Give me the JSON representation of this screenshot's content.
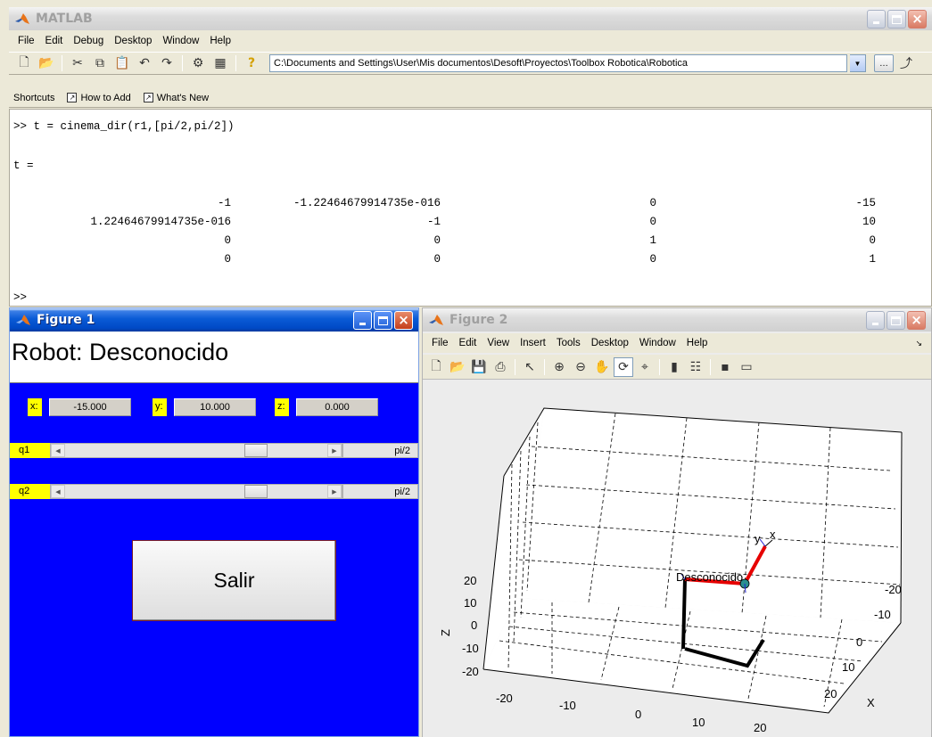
{
  "matlab": {
    "title": "MATLAB",
    "menu": [
      "File",
      "Edit",
      "Debug",
      "Desktop",
      "Window",
      "Help"
    ],
    "current_folder": "C:\\Documents and Settings\\User\\Mis documentos\\Desoft\\Proyectos\\Toolbox Robotica\\Robotica",
    "shortcuts": {
      "label": "Shortcuts",
      "how_to_add": "How to Add",
      "whats_new": "What's New"
    },
    "command_window": {
      "command": ">> t = cinema_dir(r1,[pi/2,pi/2])",
      "output_var": "t =",
      "matrix": [
        [
          "-1",
          "-1.22464679914735e-016",
          "0",
          "-15"
        ],
        [
          "1.22464679914735e-016",
          "-1",
          "0",
          "10"
        ],
        [
          "0",
          "0",
          "1",
          "0"
        ],
        [
          "0",
          "0",
          "0",
          "1"
        ]
      ],
      "prompt": ">>"
    }
  },
  "figure1": {
    "title": "Figure 1",
    "robot_label": "Robot: Desconocido",
    "x_label": "x:",
    "x_value": "-15.000",
    "y_label": "y:",
    "y_value": "10.000",
    "z_label": "z:",
    "z_value": "0.000",
    "q1_label": "q1",
    "q1_value": "pi/2",
    "q1_fraction": 0.75,
    "q2_label": "q2",
    "q2_value": "pi/2",
    "q2_fraction": 0.75,
    "exit_label": "Salir"
  },
  "figure2": {
    "title": "Figure 2",
    "menu": [
      "File",
      "Edit",
      "View",
      "Insert",
      "Tools",
      "Desktop",
      "Window",
      "Help"
    ],
    "robot_name": "Desconocido",
    "axes": {
      "xlabel": "X",
      "ylabel": "Y",
      "zlabel": "Z",
      "x_ticks": [
        "-20",
        "-10",
        "0",
        "10",
        "20"
      ],
      "y_ticks": [
        "-20",
        "-10",
        "0",
        "10",
        "20"
      ],
      "z_ticks": [
        "20",
        "10",
        "0",
        "-10",
        "-20"
      ],
      "frame_labels": {
        "y": "y",
        "x": "x"
      }
    }
  }
}
